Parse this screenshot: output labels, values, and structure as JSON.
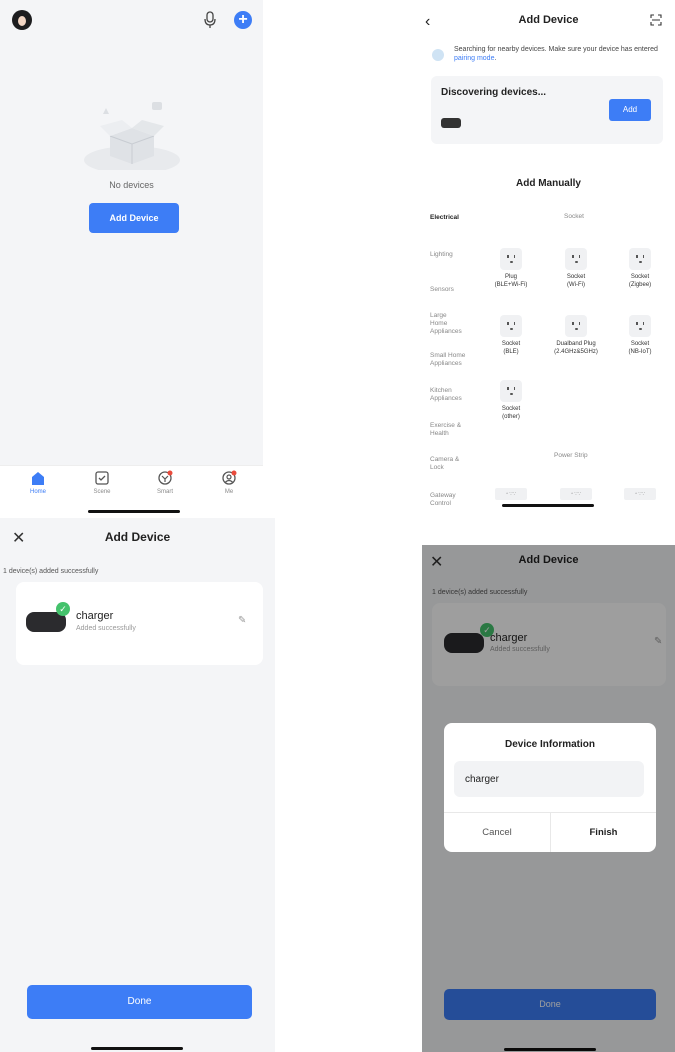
{
  "colors": {
    "accent": "#3d7df6",
    "success": "#44c26c",
    "background": "#f4f5f7"
  },
  "home": {
    "empty_text": "No devices",
    "add_button": "Add Device",
    "tabs": [
      {
        "label": "Home",
        "icon": "home-icon"
      },
      {
        "label": "Scene",
        "icon": "scene-icon"
      },
      {
        "label": "Smart",
        "icon": "smart-icon"
      },
      {
        "label": "Me",
        "icon": "me-icon"
      }
    ]
  },
  "add_device": {
    "title": "Add Device",
    "search_text": "Searching for nearby devices. Make sure your device has entered",
    "search_link": "pairing mode",
    "search_end": ".",
    "discovering": "Discovering devices...",
    "add_button": "Add",
    "add_manually": "Add Manually",
    "categories": [
      "Electrical",
      "Lighting",
      "Sensors",
      "Large Home Appliances",
      "Small Home Appliances",
      "Kitchen Appliances",
      "Exercise & Health",
      "Camera & Lock",
      "Gateway Control"
    ],
    "section_socket": "Socket",
    "section_power_strip": "Power Strip",
    "items": [
      {
        "label1": "Plug",
        "label2": "(BLE+Wi-Fi)"
      },
      {
        "label1": "Socket",
        "label2": "(Wi-Fi)"
      },
      {
        "label1": "Socket",
        "label2": "(Zigbee)"
      },
      {
        "label1": "Socket",
        "label2": "(BLE)"
      },
      {
        "label1": "Dualband Plug",
        "label2": "(2.4GHz&5GHz)"
      },
      {
        "label1": "Socket",
        "label2": "(NB-IoT)"
      },
      {
        "label1": "Socket",
        "label2": "(other)"
      }
    ]
  },
  "added": {
    "title": "Add Device",
    "status": "1 device(s) added successfully",
    "device_name": "charger",
    "device_status": "Added successfully",
    "done": "Done"
  },
  "dialog": {
    "title": "Device Information",
    "input_value": "charger",
    "cancel": "Cancel",
    "finish": "Finish"
  }
}
